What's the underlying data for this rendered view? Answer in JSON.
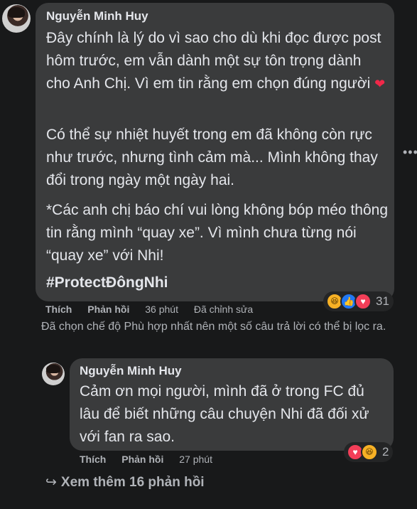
{
  "comment": {
    "author": "Nguyễn Minh Huy",
    "paragraphs": [
      "Đây chính là lý do vì sao cho dù khi đọc được post hôm trước, em vẫn dành một sự tôn trọng dành cho Anh Chị. Vì em tin rằng em chọn đúng người",
      "Có thể sự nhiệt huyết trong em đã không còn rực như trước, nhưng tình cảm mà... Mình không thay đổi trong ngày một ngày hai.",
      "*Các anh chị báo chí vui lòng không bóp méo thông tin rằng mình “quay xe”. Vì mình chưa từng nói “quay xe” với Nhi!",
      "#ProtectĐôngNhi"
    ],
    "heart_emoji": "❤",
    "actions": {
      "like": "Thích",
      "reply": "Phản hồi",
      "time": "36 phút",
      "edited": "Đã chỉnh sửa"
    },
    "reactions": {
      "icons": [
        "haha-icon",
        "like-icon",
        "love-icon"
      ],
      "count": "31"
    },
    "more_options": "•••"
  },
  "filter_notice": "Đã chọn chế độ Phù hợp nhất nên một số câu trả lời có thể bị lọc ra.",
  "reply": {
    "author": "Nguyễn Minh Huy",
    "text": "Cảm ơn mọi người, mình đã ở trong FC đủ lâu để biết những câu chuyện Nhi đã đối xử với fan ra sao.",
    "actions": {
      "like": "Thích",
      "reply": "Phản hồi",
      "time": "27 phút"
    },
    "reactions": {
      "icons": [
        "love-icon",
        "haha-icon"
      ],
      "count": "2"
    }
  },
  "view_more": {
    "arrow": "↪",
    "label": "Xem thêm 16 phản hồi"
  },
  "colors": {
    "background": "#18191a",
    "bubble": "#3a3b3c",
    "text": "#e4e6eb",
    "secondary": "#b0b3b8",
    "love": "#f33e58",
    "like": "#2078f4",
    "haha": "#f7b125"
  }
}
